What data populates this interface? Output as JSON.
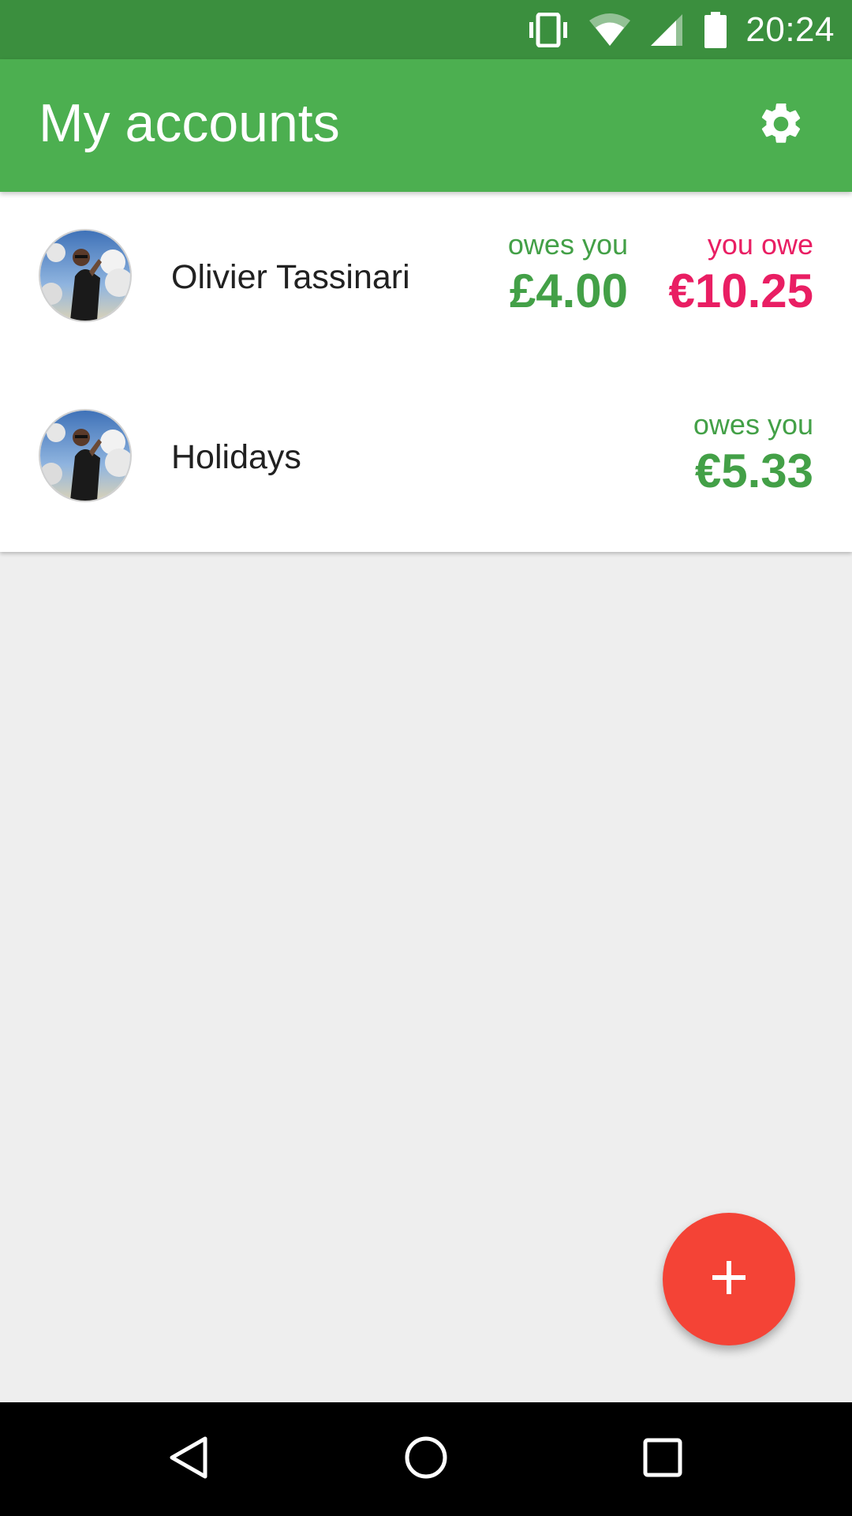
{
  "status_bar": {
    "time": "20:24",
    "icons": [
      "vibrate-icon",
      "wifi-icon",
      "cell-signal-icon",
      "battery-icon"
    ]
  },
  "app_bar": {
    "title": "My accounts",
    "settings_icon": "gear-icon"
  },
  "accounts": [
    {
      "name": "Olivier Tassinari",
      "avatar": "avatar-photo",
      "balances": [
        {
          "label": "owes you",
          "amount": "£4.00",
          "color": "#43a047"
        },
        {
          "label": "you owe",
          "amount": "€10.25",
          "color": "#e91e63"
        }
      ]
    },
    {
      "name": "Holidays",
      "avatar": "avatar-photo",
      "balances": [
        {
          "label": "owes you",
          "amount": "€5.33",
          "color": "#43a047"
        }
      ]
    }
  ],
  "fab": {
    "icon": "plus-icon",
    "color": "#f44336"
  },
  "nav_bar": {
    "icons": [
      "back-icon",
      "home-icon",
      "recents-icon"
    ]
  },
  "colors": {
    "primary": "#4caf50",
    "primary_dark": "#3b8f3e",
    "positive": "#43a047",
    "negative": "#e91e63",
    "background": "#eeeeee"
  }
}
